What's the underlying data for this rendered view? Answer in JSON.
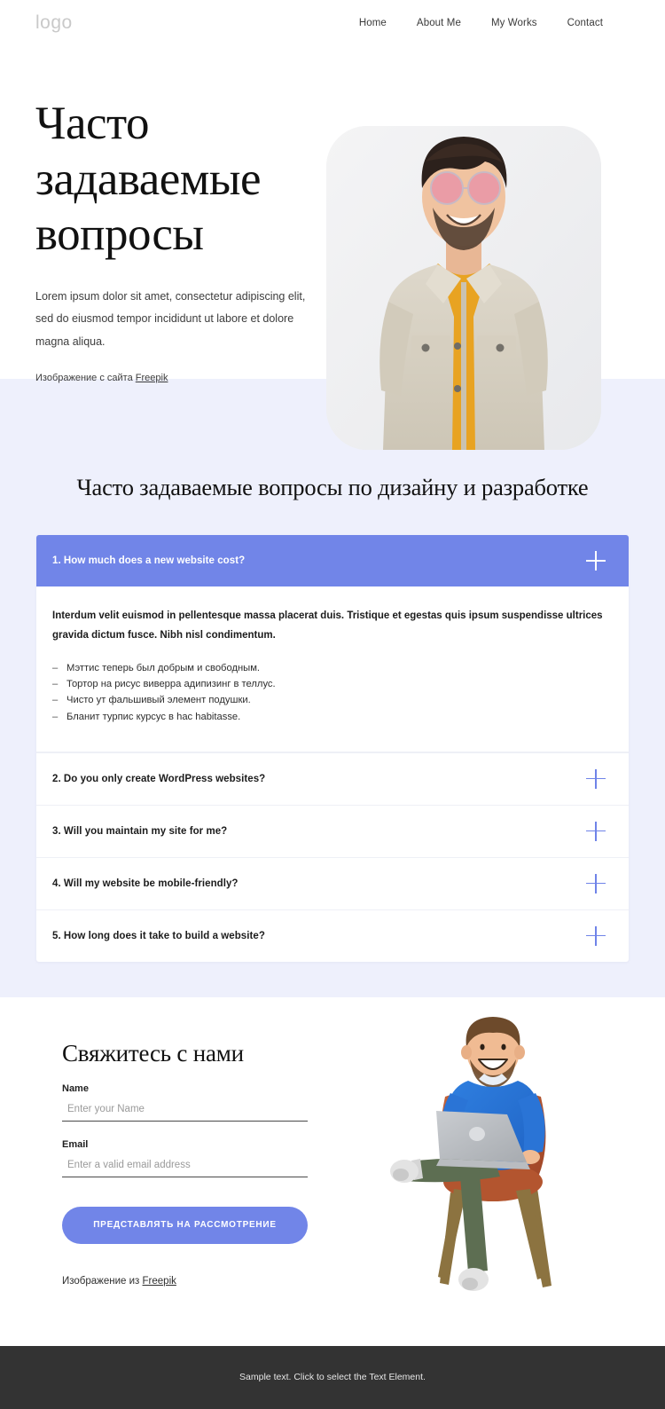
{
  "header": {
    "logo": "logo",
    "nav": [
      {
        "label": "Home"
      },
      {
        "label": "About Me"
      },
      {
        "label": "My Works"
      },
      {
        "label": "Contact"
      }
    ]
  },
  "hero": {
    "title": "Часто задаваемые вопросы",
    "subtitle": "Lorem ipsum dolor sit amet, consectetur adipiscing elit, sed do eiusmod tempor incididunt ut labore et dolore magna aliqua.",
    "credit_prefix": "Изображение с сайта ",
    "credit_link": "Freepik",
    "photo_alt": "smiling-man-in-beige-denim-jacket-with-pink-sunglasses"
  },
  "faq": {
    "heading": "Часто задаваемые вопросы по дизайну и разработке",
    "items": [
      {
        "question": "1. How much does a new website cost?",
        "open": true,
        "lead": "Interdum velit euismod in pellentesque massa placerat duis. Tristique et egestas quis ipsum suspendisse ultrices gravida dictum fusce. Nibh nisl condimentum.",
        "bullets": [
          "Мэттис теперь был добрым и свободным.",
          "Тортор на рисус виверра адипизинг в теллус.",
          "Чисто ут фальшивый элемент подушки.",
          "Бланит турпис курсус в hac habitasse."
        ]
      },
      {
        "question": "2. Do you only create WordPress websites?",
        "open": false
      },
      {
        "question": "3. Will you maintain my site for me?",
        "open": false
      },
      {
        "question": "4. Will my website be mobile-friendly?",
        "open": false
      },
      {
        "question": "5. How long does it take to build a website?",
        "open": false
      }
    ]
  },
  "contact": {
    "title": "Свяжитесь с нами",
    "name_label": "Name",
    "name_placeholder": "Enter your Name",
    "name_value": "",
    "email_label": "Email",
    "email_placeholder": "Enter a valid email address",
    "email_value": "",
    "submit_label": "ПРЕДСТАВЛЯТЬ НА РАССМОТРЕНИЕ",
    "credit_prefix": "Изображение из ",
    "credit_link": "Freepik",
    "illustration_alt": "3d-character-man-with-laptop-sitting-on-orange-armchair"
  },
  "footer": {
    "text": "Sample text. Click to select the Text Element."
  },
  "colors": {
    "accent": "#7185e8",
    "lavender_bg": "#eef0fc",
    "footer_bg": "#333333",
    "logo_gray": "#c9c9c9"
  }
}
